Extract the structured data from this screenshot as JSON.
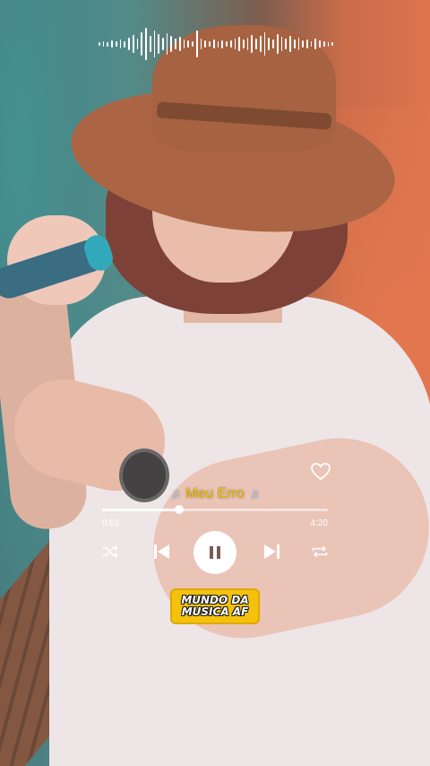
{
  "player": {
    "song_title": "Meu Erro",
    "elapsed_time": "0:01",
    "total_time": "4:20",
    "progress": 0.34,
    "liked": false
  },
  "branding": {
    "line1": "MUNDO DA",
    "line2": "MUSICA AF"
  },
  "icons": {
    "waveform": "audio-waveform-icon",
    "heart": "heart-outline-icon",
    "shuffle": "shuffle-icon",
    "previous": "skip-previous-icon",
    "pause": "pause-icon",
    "next": "skip-next-icon",
    "repeat": "repeat-icon",
    "note": "music-note-icon"
  },
  "colors": {
    "title": "#f2c200",
    "controls": "#ffffff",
    "brand_badge": "#f4c20d"
  }
}
